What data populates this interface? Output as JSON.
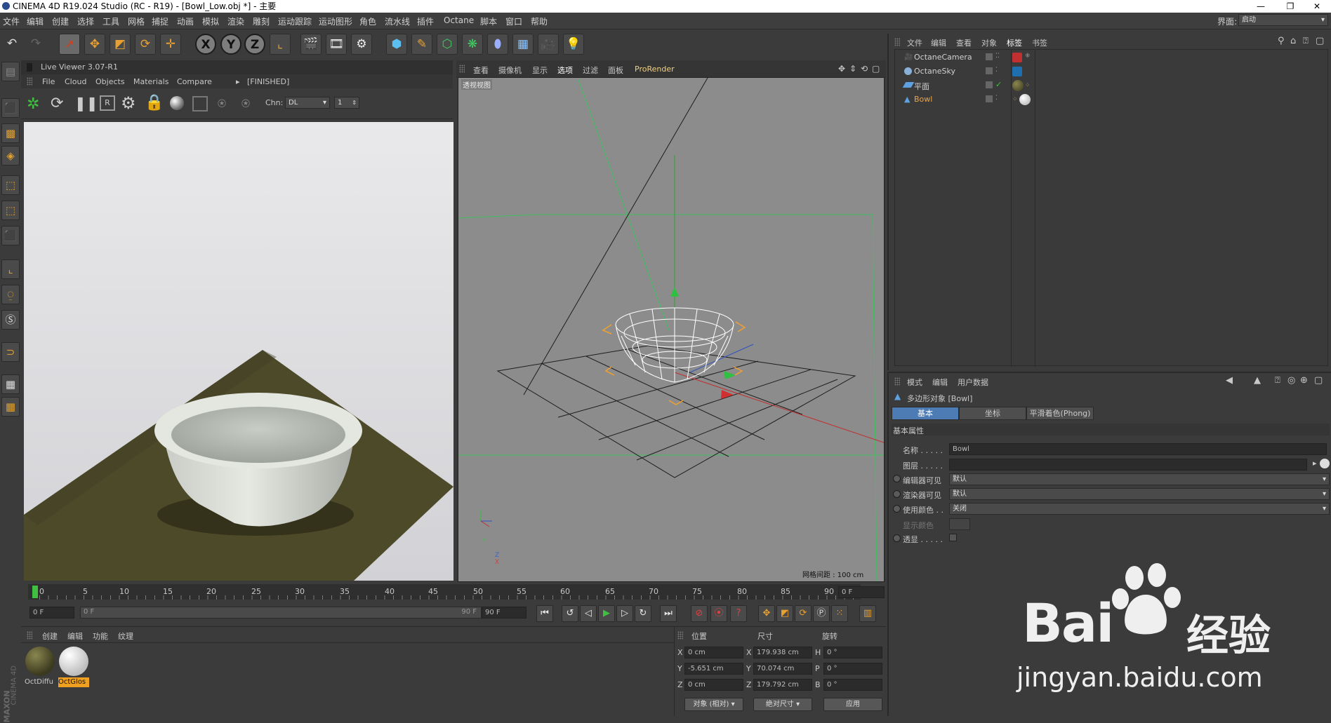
{
  "window": {
    "title": "CINEMA 4D R19.024 Studio (RC - R19) - [Bowl_Low.obj *] - 主要",
    "minimize": "—",
    "restore": "❐",
    "close": "✕"
  },
  "menubar": {
    "items": [
      "文件",
      "编辑",
      "创建",
      "选择",
      "工具",
      "网格",
      "捕捉",
      "动画",
      "模拟",
      "渲染",
      "雕刻",
      "运动跟踪",
      "运动图形",
      "角色",
      "流水线",
      "插件",
      "Octane",
      "脚本",
      "窗口",
      "帮助"
    ],
    "layout_label": "界面:",
    "layout_value": "启动"
  },
  "toolbar": {
    "icons": [
      "undo-icon",
      "redo-icon",
      "select-icon",
      "move-icon",
      "scale-icon",
      "rotate-icon",
      "live-move-icon",
      "x-axis-icon",
      "y-axis-icon",
      "z-axis-icon",
      "coord-system-icon",
      "render-view-icon",
      "render-picture-viewer-icon",
      "render-settings-icon",
      "cube-icon",
      "pen-icon",
      "subdivision-icon",
      "cloner-icon",
      "deformer-icon",
      "floor-icon",
      "camera-icon",
      "light-icon"
    ],
    "axis_x": "X",
    "axis_y": "Y",
    "axis_z": "Z"
  },
  "live_viewer": {
    "title": "Live Viewer 3.07-R1",
    "menu": [
      "File",
      "Cloud",
      "Objects",
      "Materials",
      "Compare"
    ],
    "status": "[FINISHED]",
    "chn_label": "Chn:",
    "chn_value": "DL",
    "chn_number": "1"
  },
  "viewport": {
    "menu": [
      "查看",
      "摄像机",
      "显示",
      "选项",
      "过滤",
      "面板"
    ],
    "prorender": "ProRender",
    "view_label": "透视视图",
    "grid_label": "网格间距 : 100 cm",
    "axis_y": "Y",
    "axis_z": "Z",
    "axis_x": "X"
  },
  "object_manager": {
    "menu": [
      "文件",
      "编辑",
      "查看",
      "对象",
      "标签",
      "书签"
    ],
    "objects": [
      {
        "name": "OctaneCamera",
        "icon": "camera-object-icon",
        "color": "#d0d0d0"
      },
      {
        "name": "OctaneSky",
        "icon": "sky-object-icon",
        "color": "#d0d0d0"
      },
      {
        "name": "平面",
        "icon": "plane-object-icon",
        "color": "#d0d0d0"
      },
      {
        "name": "Bowl",
        "icon": "polygon-object-icon",
        "color": "#e8a44a"
      }
    ]
  },
  "attribute_manager": {
    "menu": [
      "模式",
      "编辑",
      "用户数据"
    ],
    "object_title": "多边形对象 [Bowl]",
    "tabs": [
      "基本",
      "坐标",
      "平滑着色(Phong)"
    ],
    "section": "基本属性",
    "name_label": "名称 . . . . .",
    "name_value": "Bowl",
    "layer_label": "图层 . . . . .",
    "layer_value": "",
    "editor_visible_label": "编辑器可见",
    "editor_visible_value": "默认",
    "render_visible_label": "渲染器可见",
    "render_visible_value": "默认",
    "use_color_label": "使用颜色 . .",
    "use_color_value": "关闭",
    "display_color_label": "显示颜色",
    "xray_label": "透显 . . . . ."
  },
  "timeline": {
    "ticks": [
      "0",
      "5",
      "10",
      "15",
      "20",
      "25",
      "30",
      "35",
      "40",
      "45",
      "50",
      "55",
      "60",
      "65",
      "70",
      "75",
      "80",
      "85",
      "90"
    ],
    "current_frame": "0 F",
    "start_frame": "0 F",
    "range_start": "0 F",
    "range_end": "90 F",
    "end_frame": "90 F"
  },
  "material_manager": {
    "menu": [
      "创建",
      "编辑",
      "功能",
      "纹理"
    ],
    "materials": [
      {
        "name": "OctDiffu",
        "color": "#4d4a2a"
      },
      {
        "name": "OctGlos",
        "color": "#e8e8e4"
      }
    ],
    "brand_top": "MAXON",
    "brand_bottom": "CINEMA 4D"
  },
  "coord_manager": {
    "headers": [
      "位置",
      "尺寸",
      "旋转"
    ],
    "pos": {
      "x": "0 cm",
      "y": "-5.651 cm",
      "z": "0 cm"
    },
    "size": {
      "x": "179.938 cm",
      "y": "70.074 cm",
      "z": "179.792 cm"
    },
    "rot": {
      "h": "0 °",
      "p": "0 °",
      "b": "0 °"
    },
    "labels": {
      "x": "X",
      "y": "Y",
      "z": "Z",
      "h": "H",
      "p": "P",
      "b": "B"
    },
    "mode_dropdown": "对象 (相对)",
    "size_dropdown": "绝对尺寸",
    "apply": "应用"
  },
  "watermark": {
    "logo": "Bai",
    "logo_suffix": "经验",
    "url": "jingyan.baidu.com"
  },
  "colors": {
    "accent": "#4d7bb4",
    "selected_object": "#e8a44a",
    "viewport_bg": "#8c8c8c",
    "plane_color": "#4d4a2a"
  }
}
